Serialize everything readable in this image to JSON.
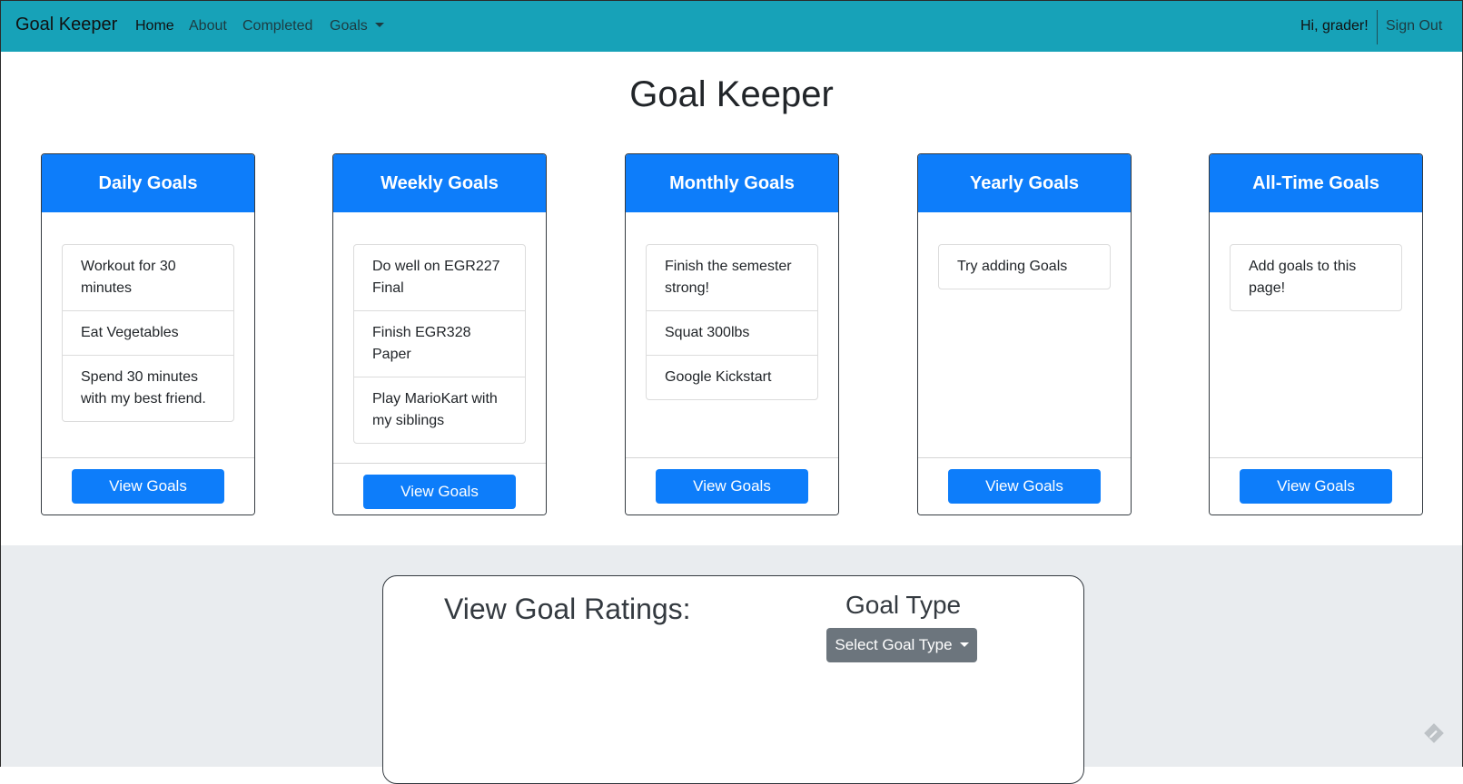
{
  "navbar": {
    "brand": "Goal Keeper",
    "links": [
      "Home",
      "About",
      "Completed"
    ],
    "goals_dropdown": "Goals",
    "greeting": "Hi, grader!",
    "sign_out": "Sign Out",
    "background_color": "#17a2b8"
  },
  "main": {
    "title": "Goal Keeper",
    "cards": [
      {
        "title": "Daily Goals",
        "goals": [
          "Workout for 30 minutes",
          "Eat Vegetables",
          "Spend 30 minutes with my best friend."
        ],
        "button": "View Goals"
      },
      {
        "title": "Weekly Goals",
        "goals": [
          "Do well on EGR227 Final",
          "Finish EGR328 Paper",
          "Play MarioKart with my siblings"
        ],
        "button": "View Goals"
      },
      {
        "title": "Monthly Goals",
        "goals": [
          "Finish the semester strong!",
          "Squat 300lbs",
          "Google Kickstart"
        ],
        "button": "View Goals"
      },
      {
        "title": "Yearly Goals",
        "goals": [
          "Try adding Goals"
        ],
        "button": "View Goals"
      },
      {
        "title": "All-Time Goals",
        "goals": [
          "Add goals to this page!"
        ],
        "button": "View Goals"
      }
    ]
  },
  "ratings": {
    "title": "View Goal Ratings:",
    "goal_type_heading": "Goal Type",
    "select_label": "Select Goal Type"
  },
  "colors": {
    "primary": "#0d7dfa",
    "secondary": "#6c757d",
    "section_background": "#e9ecef"
  },
  "icons": {
    "floating": "pencil-edit-icon"
  }
}
